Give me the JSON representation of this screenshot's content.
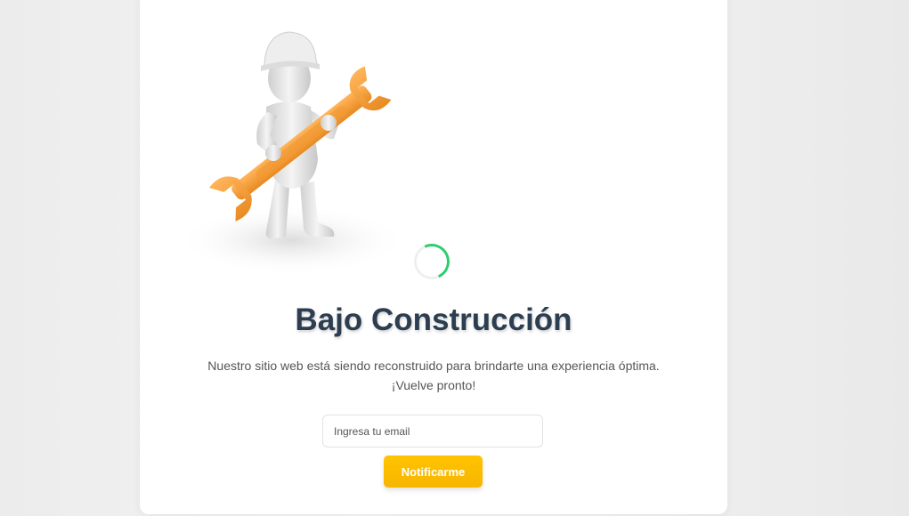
{
  "page": {
    "title": "Bajo Construcción",
    "description_line1": "Nuestro sitio web está siendo reconstruido para brindarte una experiencia óptima.",
    "description_line2": "¡Vuelve pronto!"
  },
  "form": {
    "email_placeholder": "Ingresa tu email",
    "email_value": "",
    "notify_label": "Notificarme"
  },
  "illustration": {
    "icon": "worker-with-wrench-icon"
  },
  "loader": {
    "icon": "loading-spinner-icon"
  },
  "colors": {
    "title": "#2c3e50",
    "button": "#ffc107",
    "spinner": "#2ecc71",
    "wrench": "#f5a03b"
  }
}
